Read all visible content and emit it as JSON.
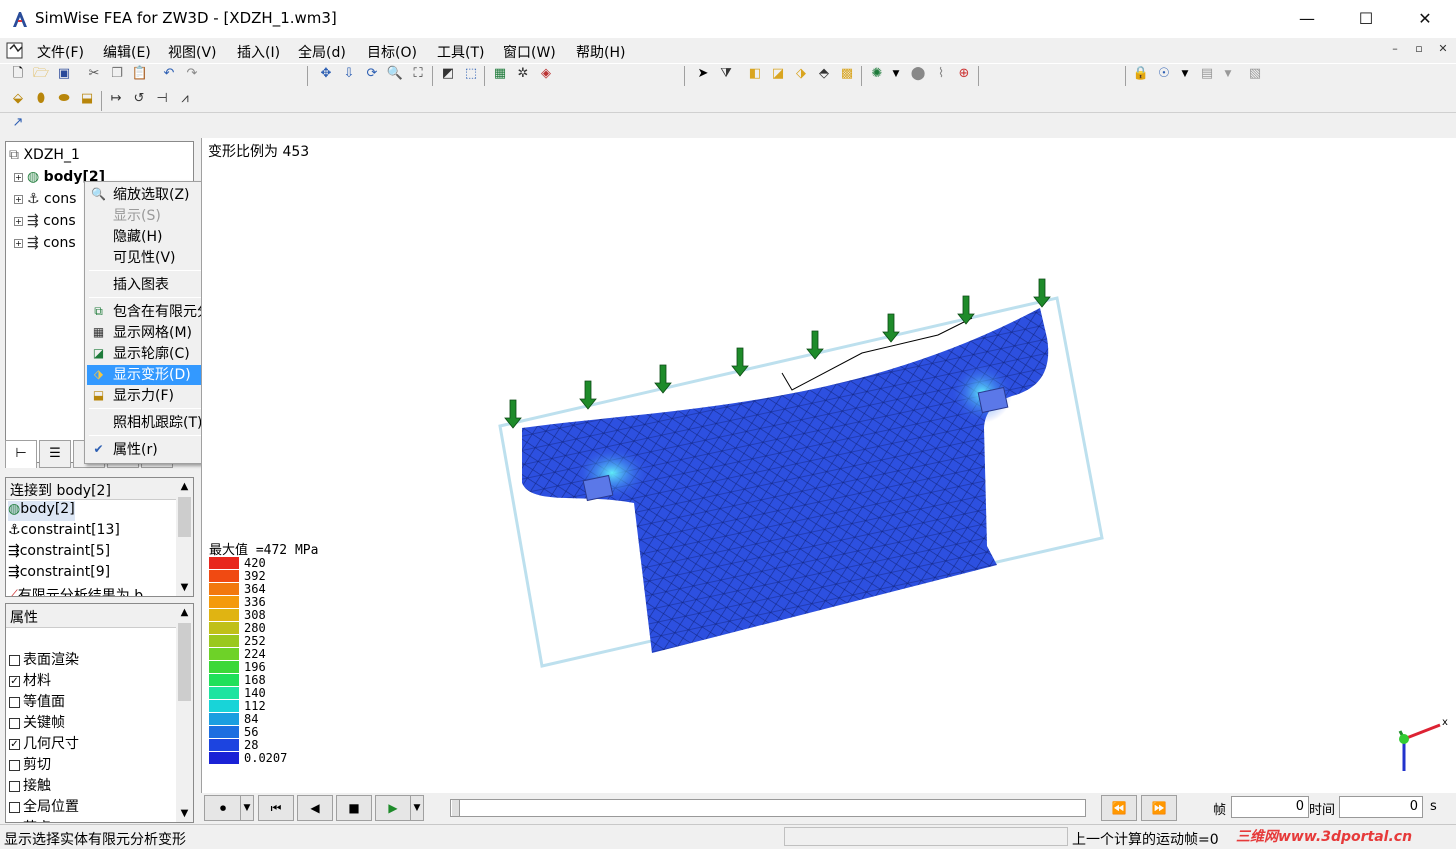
{
  "window": {
    "title": "SimWise FEA for ZW3D - [XDZH_1.wm3]",
    "controls": [
      "—",
      "☐",
      "✕"
    ]
  },
  "menubar": {
    "items": [
      "文件(F)",
      "编辑(E)",
      "视图(V)",
      "插入(I)",
      "全局(d)",
      "目标(O)",
      "工具(T)",
      "窗口(W)",
      "帮助(H)"
    ],
    "mdi_controls": [
      "–",
      "▫",
      "✕"
    ]
  },
  "tree": {
    "root": "XDZH_1",
    "items": [
      "body[2]",
      "cons",
      "cons",
      "cons"
    ]
  },
  "context_menu": {
    "items": [
      {
        "label": "缩放选取(Z)",
        "icon": "zoom-icon"
      },
      {
        "label": "显示(S)",
        "disabled": true
      },
      {
        "label": "隐藏(H)"
      },
      {
        "label": "可见性(V)",
        "submenu": true
      },
      {
        "label": "插入图表",
        "submenu": true
      },
      {
        "label": "包含在有限元分析中(I)",
        "icon": "fea-include-icon"
      },
      {
        "label": "显示网格(M)",
        "icon": "mesh-icon"
      },
      {
        "label": "显示轮廓(C)",
        "icon": "contour-icon"
      },
      {
        "label": "显示变形(D)",
        "icon": "deform-icon",
        "selected": true
      },
      {
        "label": "显示力(F)",
        "icon": "force-icon"
      },
      {
        "label": "照相机跟踪(T)"
      },
      {
        "label": "属性(r)",
        "icon": "check-icon"
      }
    ]
  },
  "connections": {
    "header": "连接到 body[2]",
    "items": [
      "body[2]",
      "constraint[13]",
      "constraint[5]",
      "constraint[9]",
      "有限元分析结果为 b"
    ]
  },
  "properties": {
    "header": "属性",
    "items": [
      {
        "label": "表面渲染",
        "checked": false
      },
      {
        "label": "材料",
        "checked": true
      },
      {
        "label": "等值面",
        "checked": false
      },
      {
        "label": "关键帧",
        "checked": false
      },
      {
        "label": "几何尺寸",
        "checked": true
      },
      {
        "label": "剪切",
        "checked": false
      },
      {
        "label": "接触",
        "checked": false
      },
      {
        "label": "全局位置",
        "checked": false
      },
      {
        "label": "节点",
        "checked": false
      }
    ]
  },
  "viewport": {
    "deformation_label": "变形比例为 453",
    "legend_title": "最大值 =472 MPa",
    "legend_values": [
      "420",
      "392",
      "364",
      "336",
      "308",
      "280",
      "252",
      "224",
      "196",
      "168",
      "140",
      "112",
      "84",
      "56",
      "28",
      "0.0207"
    ],
    "legend_colors": [
      "#e8261c",
      "#f04a12",
      "#f2780e",
      "#f49a0c",
      "#e0b412",
      "#c0c018",
      "#9ac81e",
      "#6ed228",
      "#3cd838",
      "#20e05a",
      "#1ce4a0",
      "#18d4d8",
      "#1a9ee0",
      "#1c6ee0",
      "#1c44e0",
      "#1a22d6"
    ]
  },
  "playbar": {
    "frame_label": "帧",
    "frame_value": "0",
    "time_label": "时间",
    "time_value": "0",
    "time_unit": "s"
  },
  "statusbar": {
    "left": "显示选择实体有限元分析变形",
    "right": "上一个计算的运动帧=0",
    "watermark": "三维网www.3dportal.cn"
  }
}
